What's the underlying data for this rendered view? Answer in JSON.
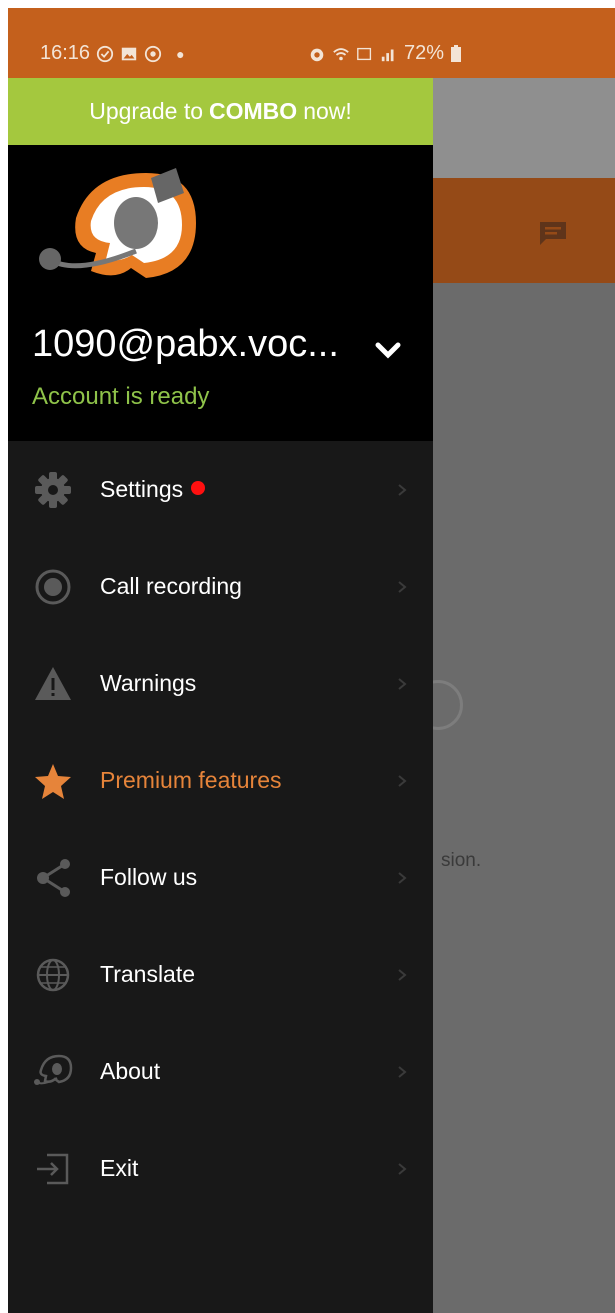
{
  "status_bar": {
    "time": "16:16",
    "battery": "72%"
  },
  "background": {
    "partial_text": "sion."
  },
  "drawer": {
    "upgrade": {
      "prefix": "Upgrade to",
      "brand": "COMBO",
      "suffix": "now!"
    },
    "account": {
      "name": "1090@pabx.voc...",
      "status": "Account is ready"
    },
    "menu": [
      {
        "label": "Settings",
        "icon": "gear-icon",
        "badge": "red-dot"
      },
      {
        "label": "Call recording",
        "icon": "record-icon"
      },
      {
        "label": "Warnings",
        "icon": "warning-icon"
      },
      {
        "label": "Premium features",
        "icon": "star-icon",
        "accent": "#e6843a"
      },
      {
        "label": "Follow us",
        "icon": "share-icon"
      },
      {
        "label": "Translate",
        "icon": "globe-icon"
      },
      {
        "label": "About",
        "icon": "logo-icon"
      },
      {
        "label": "Exit",
        "icon": "exit-icon"
      }
    ]
  },
  "colors": {
    "status_bar": "#c4601c",
    "upgrade_banner": "#a4c83e",
    "account_ready": "#8fc34a",
    "premium_accent": "#e6843a",
    "drawer_bg": "#181818"
  }
}
